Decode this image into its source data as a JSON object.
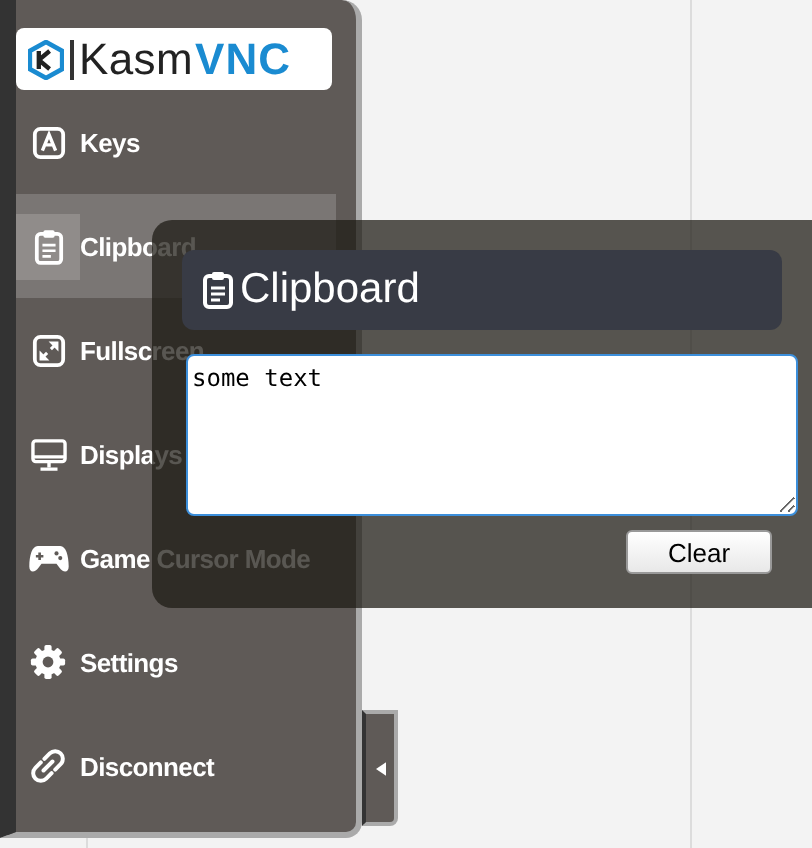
{
  "logo": {
    "part_1": "Kasm",
    "part_2": "VNC"
  },
  "menu": [
    {
      "kind": "keys",
      "label": "Keys",
      "selected": false
    },
    {
      "kind": "clipboard",
      "label": "Clipboard",
      "selected": true
    },
    {
      "kind": "fullscreen",
      "label": "Fullscreen",
      "selected": false
    },
    {
      "kind": "displays",
      "label": "Displays",
      "selected": false
    },
    {
      "kind": "gamepad",
      "label": "Game Cursor Mode",
      "selected": false
    },
    {
      "kind": "settings",
      "label": "Settings",
      "selected": false
    },
    {
      "kind": "disconnect",
      "label": "Disconnect",
      "selected": false
    }
  ],
  "clipboard_panel": {
    "title": "Clipboard",
    "text": "some text",
    "button": "Clear"
  }
}
